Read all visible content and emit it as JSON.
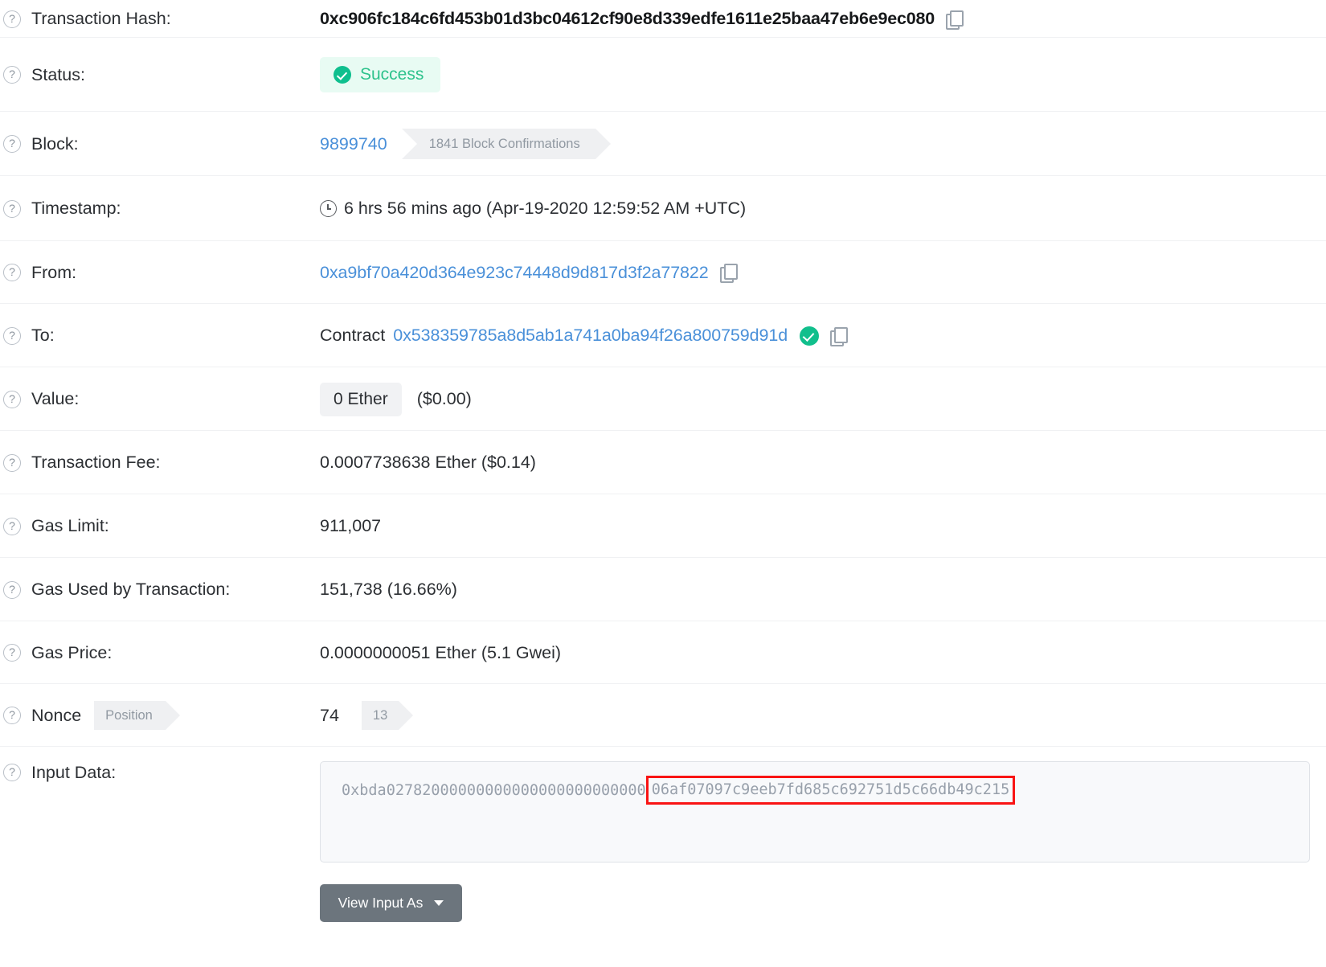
{
  "rows": {
    "transaction_hash": {
      "label": "Transaction Hash:",
      "value": "0xc906fc184c6fd453b01d3bc04612cf90e8d339edfe1611e25baa47eb6e9ec080",
      "copy_icon": "copy-icon"
    },
    "status": {
      "label": "Status:",
      "value": "Success",
      "icon": "check-circle-icon",
      "badge_bg": "#e8fbf3",
      "badge_color": "#2dc28c"
    },
    "block": {
      "label": "Block:",
      "number": "9899740",
      "confirmations": "1841 Block Confirmations"
    },
    "timestamp": {
      "label": "Timestamp:",
      "icon": "clock-icon",
      "value": "6 hrs 56 mins ago (Apr-19-2020 12:59:52 AM +UTC)"
    },
    "from": {
      "label": "From:",
      "address": "0xa9bf70a420d364e923c74448d9d817d3f2a77822",
      "copy_icon": "copy-icon"
    },
    "to": {
      "label": "To:",
      "prefix": "Contract",
      "address": "0x538359785a8d5ab1a741a0ba94f26a800759d91d",
      "verified_icon": "verified-check-icon",
      "copy_icon": "copy-icon"
    },
    "value": {
      "label": "Value:",
      "ether": "0 Ether",
      "usd": "($0.00)"
    },
    "transaction_fee": {
      "label": "Transaction Fee:",
      "value": "0.0007738638 Ether ($0.14)"
    },
    "gas_limit": {
      "label": "Gas Limit:",
      "value": "911,007"
    },
    "gas_used": {
      "label": "Gas Used by Transaction:",
      "value": "151,738 (16.66%)"
    },
    "gas_price": {
      "label": "Gas Price:",
      "value": "0.0000000051 Ether (5.1 Gwei)"
    },
    "nonce": {
      "label": "Nonce",
      "position_tag": "Position",
      "value": "74",
      "index": "13"
    },
    "input_data": {
      "label": "Input Data:",
      "prefix": "0xbda02782000000000000000000000000",
      "highlighted": "06af07097c9eeb7fd685c692751d5c66db49c215",
      "highlight_color": "#f91414",
      "button_label": "View Input As",
      "button_caret": "chevron-down-icon"
    }
  }
}
